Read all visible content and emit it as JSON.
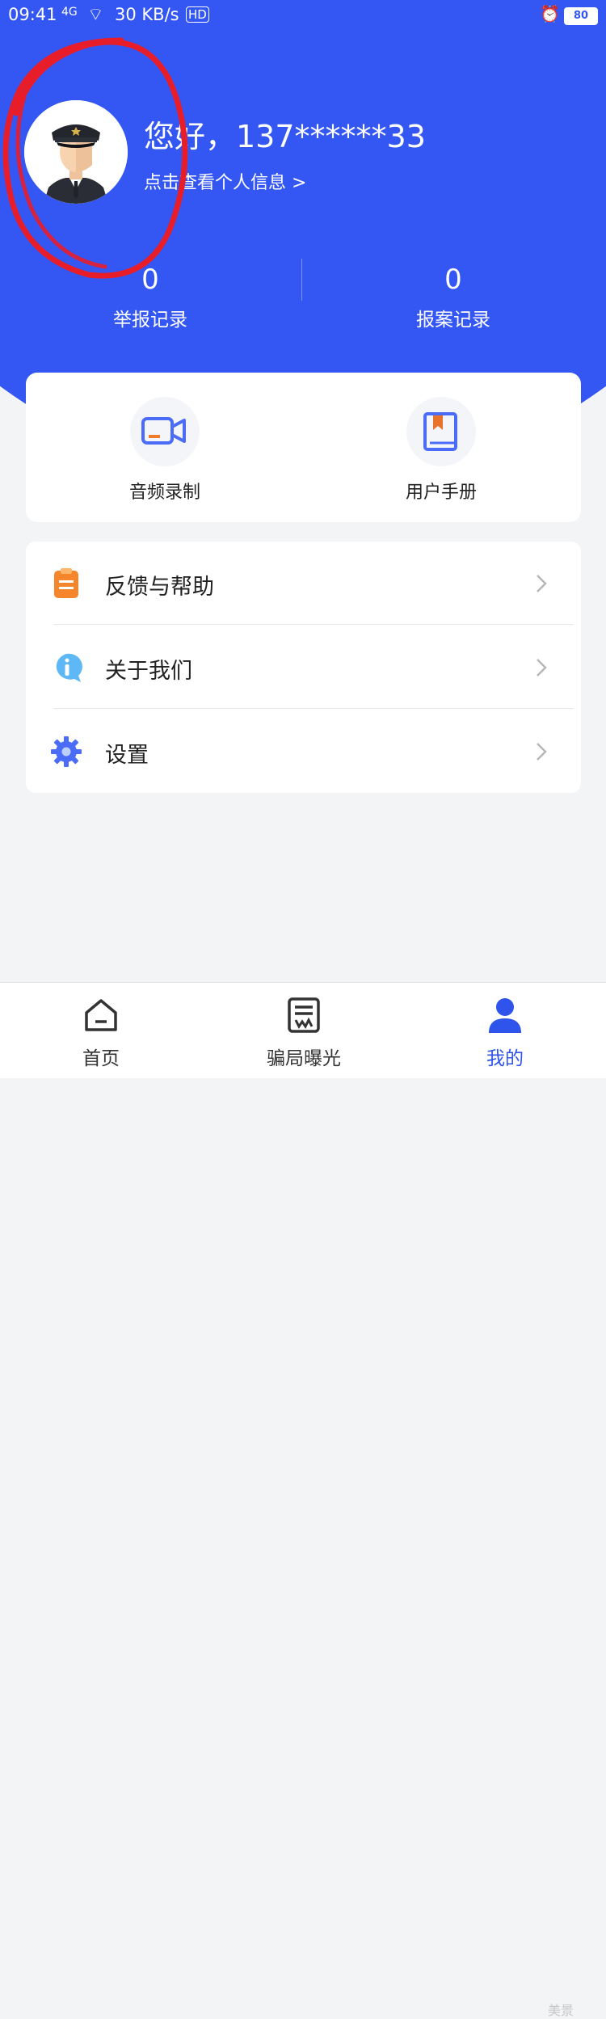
{
  "status_bar": {
    "time": "09:41",
    "signal": "4G",
    "network_speed": "30 KB/s",
    "hd": "HD",
    "battery": "80"
  },
  "profile": {
    "greeting": "您好，137******33",
    "link": "点击查看个人信息 >"
  },
  "stats": [
    {
      "value": "0",
      "label": "举报记录"
    },
    {
      "value": "0",
      "label": "报案记录"
    }
  ],
  "tools": [
    {
      "label": "音频录制",
      "icon": "video-record-icon"
    },
    {
      "label": "用户手册",
      "icon": "manual-book-icon"
    }
  ],
  "menu": [
    {
      "label": "反馈与帮助",
      "icon": "clipboard-icon"
    },
    {
      "label": "关于我们",
      "icon": "info-icon"
    },
    {
      "label": "设置",
      "icon": "gear-icon"
    }
  ],
  "tabs": [
    {
      "label": "首页",
      "icon": "home-icon"
    },
    {
      "label": "骗局曝光",
      "icon": "news-icon"
    },
    {
      "label": "我的",
      "icon": "user-icon",
      "active": true
    }
  ],
  "watermark": "美景",
  "colors": {
    "primary": "#3457f4",
    "active_tab": "#2f54eb",
    "annotation_mark": "#e81d2a"
  }
}
